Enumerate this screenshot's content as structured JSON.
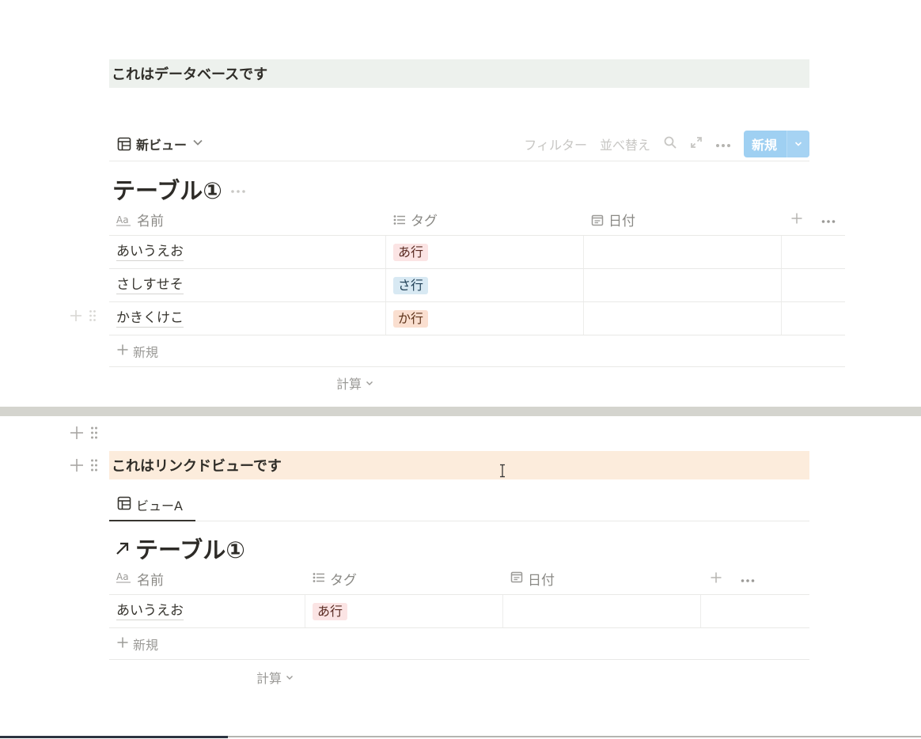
{
  "callout1": {
    "text": "これはデータベースです"
  },
  "toolbar": {
    "view_label": "新ビュー",
    "filter_label": "フィルター",
    "sort_label": "並べ替え",
    "new_label": "新規"
  },
  "database": {
    "title": "テーブル①",
    "columns": {
      "name": "名前",
      "tag": "タグ",
      "date": "日付"
    },
    "rows": [
      {
        "name": "あいうえお",
        "tag": "あ行"
      },
      {
        "name": "さしすせそ",
        "tag": "さ行"
      },
      {
        "name": "かきくけこ",
        "tag": "か行"
      }
    ],
    "new_row_label": "新規",
    "calc_label": "計算"
  },
  "callout2": {
    "text": "これはリンクドビューです"
  },
  "linked": {
    "tab_label": "ビューA",
    "title": "テーブル①",
    "columns": {
      "name": "名前",
      "tag": "タグ",
      "date": "日付"
    },
    "rows": [
      {
        "name": "あいうえお",
        "tag": "あ行"
      }
    ],
    "new_row_label": "新規",
    "calc_label": "計算"
  },
  "colors": {
    "callout_green": "#edf1ed",
    "callout_orange": "#fcecdc",
    "new_button": "#9fd0f2",
    "tag_a": "#fbe4e4",
    "tag_sa": "#d8e9f3",
    "tag_ka": "#fadfd0",
    "separator": "#d4d4ce"
  },
  "icons": [
    "table-icon",
    "chevron-down-icon",
    "search-icon",
    "expand-icon",
    "more-icon",
    "text-property-icon",
    "list-property-icon",
    "calendar-icon",
    "plus-icon",
    "drag-handle-icon",
    "link-arrow-icon",
    "text-cursor-icon"
  ]
}
